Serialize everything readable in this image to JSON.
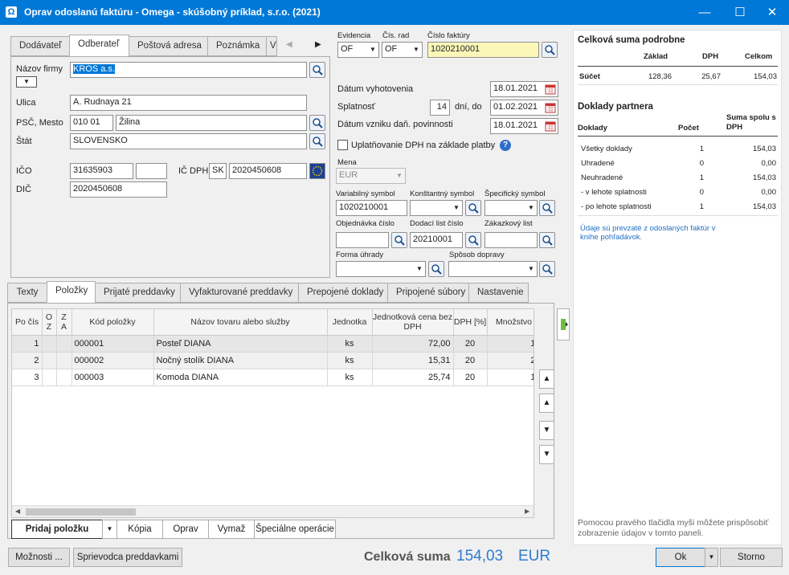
{
  "window": {
    "title": "Oprav odoslanú faktúru - Omega - skúšobný príklad, s.r.o. (2021)",
    "app_icon": "Ω"
  },
  "partner_tabs": [
    "Dodávateľ",
    "Odberateľ",
    "Poštová adresa",
    "Poznámka",
    "V"
  ],
  "partner_tabs_active": 1,
  "partner": {
    "name_label": "Názov firmy",
    "name": "KROS a.s.",
    "street_label": "Ulica",
    "street": "A. Rudnaya 21",
    "zip_city_label": "PSČ, Mesto",
    "zip": "010 01",
    "city": "Žilina",
    "state_label": "Štát",
    "state": "SLOVENSKO",
    "ico_label": "IČO",
    "ico": "31635903",
    "icdph_label": "IČ DPH",
    "icdph_prefix": "SK",
    "icdph": "2020450608",
    "dic_label": "DIČ",
    "dic": "2020450608"
  },
  "header": {
    "evidencia_label": "Evidencia",
    "evidencia": "OF",
    "cis_rad_label": "Čís. rad",
    "cis_rad": "OF",
    "invoice_no_label": "Číslo faktúry",
    "invoice_no": "1020210001",
    "date_issued_label": "Dátum vyhotovenia",
    "date_issued": "18.01.2021",
    "due_label": "Splatnosť",
    "due_days": "14",
    "due_days_label": "dní, do",
    "due_date": "01.02.2021",
    "tax_date_label": "Dátum vzniku daň. povinnosti",
    "tax_date": "18.01.2021",
    "vat_payment_label": "Uplatňovanie DPH na základe platby",
    "currency_label": "Mena",
    "currency": "EUR",
    "variable_label": "Variabilný symbol",
    "variable": "1020210001",
    "constant_label": "Konštantný symbol",
    "specific_label": "Špecifický symbol",
    "order_label": "Objednávka číslo",
    "delivery_label": "Dodací list číslo",
    "delivery": "20210001",
    "customer_order_label": "Zákazkový list",
    "payment_form_label": "Forma úhrady",
    "shipping_label": "Spôsob dopravy"
  },
  "bottom_tabs": [
    "Texty",
    "Položky",
    "Prijaté preddavky",
    "Vyfakturované preddavky",
    "Prepojené doklady",
    "Pripojené súbory",
    "Nastavenie"
  ],
  "bottom_tabs_active": 1,
  "grid": {
    "headers": {
      "pc": "Po čís",
      "o": "O",
      "z": "Z",
      "oz": "Z",
      "a": "A",
      "code": "Kód položky",
      "name": "Názov tovaru alebo služby",
      "unit": "Jednotka",
      "price": "Jednotková cena bez DPH",
      "vat": "DPH [%]",
      "qty": "Množstvo"
    },
    "rows": [
      {
        "pc": "1",
        "code": "000001",
        "name": "Posteľ DIANA",
        "unit": "ks",
        "price": "72,00",
        "vat": "20",
        "qty": "1,"
      },
      {
        "pc": "2",
        "code": "000002",
        "name": "Nočný stolík DIANA",
        "unit": "ks",
        "price": "15,31",
        "vat": "20",
        "qty": "2,"
      },
      {
        "pc": "3",
        "code": "000003",
        "name": "Komoda DIANA",
        "unit": "ks",
        "price": "25,74",
        "vat": "20",
        "qty": "1,"
      }
    ]
  },
  "grid_buttons": {
    "add": "Pridaj položku",
    "copy": "Kópia",
    "edit": "Oprav",
    "delete": "Vymaž",
    "special": "Špeciálne operácie"
  },
  "footer": {
    "options": "Možnosti ...",
    "advances": "Sprievodca preddavkami",
    "total_label": "Celková suma",
    "total_value": "154,03",
    "total_currency": "EUR",
    "ok": "Ok",
    "cancel": "Storno"
  },
  "summary": {
    "title": "Celková suma podrobne",
    "col_base": "Základ",
    "col_vat": "DPH",
    "col_total": "Celkom",
    "sum_label": "Súčet",
    "sum_base": "128,36",
    "sum_vat": "25,67",
    "sum_total": "154,03",
    "partner_title": "Doklady partnera",
    "p_col_docs": "Doklady",
    "p_col_count": "Počet",
    "p_col_sum": "Suma spolu s DPH",
    "rows": [
      {
        "label": "Všetky doklady",
        "count": "1",
        "sum": "154,03"
      },
      {
        "label": "Uhradené",
        "count": "0",
        "sum": "0,00"
      },
      {
        "label": "Neuhradené",
        "count": "1",
        "sum": "154,03"
      },
      {
        "label": "- v lehote splatnosti",
        "count": "0",
        "sum": "0,00"
      },
      {
        "label": "- po lehote splatnosti",
        "count": "1",
        "sum": "154,03"
      }
    ],
    "note": "Údaje sú prevzaté z odoslaných faktúr v knihe pohľadávok.",
    "hint": "Pomocou pravého tlačidla myši môžete prispôsobiť zobrazenie údajov v tomto paneli."
  }
}
